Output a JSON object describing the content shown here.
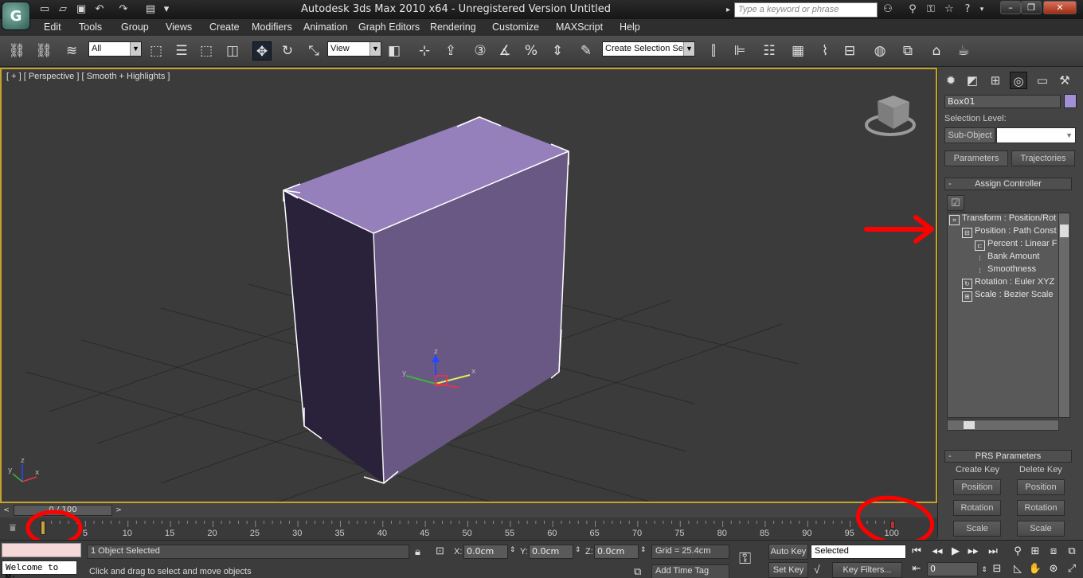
{
  "window": {
    "title": "Autodesk 3ds Max  2010 x64  -  Unregistered Version     Untitled",
    "search_placeholder": "Type a keyword or phrase"
  },
  "menu": [
    "Edit",
    "Tools",
    "Group",
    "Views",
    "Create",
    "Modifiers",
    "Animation",
    "Graph Editors",
    "Rendering",
    "Customize",
    "MAXScript",
    "Help"
  ],
  "toolbar": {
    "selection_filter": "All",
    "reference_coord": "View",
    "named_selection": "Create Selection Se"
  },
  "viewport": {
    "label": "[ + ] [ Perspective ] [ Smooth + Highlights ]",
    "object_color": "#a38fd6",
    "gizmo_labels": {
      "x": "x",
      "y": "y",
      "z": "z"
    }
  },
  "command_panel": {
    "object_name": "Box01",
    "selection_level_label": "Selection Level:",
    "sub_object_label": "Sub-Object",
    "tab_parameters": "Parameters",
    "tab_trajectories": "Trajectories",
    "assign_controller_title": "Assign Controller",
    "tree": [
      {
        "label": "Transform : Position/Rot",
        "indent": 0
      },
      {
        "label": "Position : Path Const",
        "indent": 1
      },
      {
        "label": "Percent : Linear F",
        "indent": 2
      },
      {
        "label": "Bank Amount",
        "indent": 2
      },
      {
        "label": "Smoothness",
        "indent": 2
      },
      {
        "label": "Rotation : Euler XYZ",
        "indent": 1
      },
      {
        "label": "Scale : Bezier Scale",
        "indent": 1
      }
    ],
    "prs_title": "PRS Parameters",
    "create_key": "Create Key",
    "delete_key": "Delete Key",
    "position": "Position",
    "rotation": "Rotation",
    "scale": "Scale"
  },
  "timeline": {
    "slider_label": "0 / 100",
    "current_frame": 0,
    "total_frames": 100,
    "ticks": [
      "5",
      "10",
      "15",
      "20",
      "25",
      "30",
      "35",
      "40",
      "45",
      "50",
      "55",
      "60",
      "65",
      "70",
      "75",
      "80",
      "85",
      "90",
      "95",
      "100"
    ]
  },
  "status": {
    "maxscript_listener": "Welcome to M:",
    "selection_info": "1 Object Selected",
    "prompt": "Click and drag to select and move objects",
    "x_label": "X:",
    "y_label": "Y:",
    "z_label": "Z:",
    "x_value": "0.0cm",
    "y_value": "0.0cm",
    "z_value": "0.0cm",
    "grid": "Grid = 25.4cm",
    "add_time_tag": "Add Time Tag",
    "auto_key": "Auto Key",
    "set_key": "Set Key",
    "key_mode": "Selected",
    "key_filters": "Key Filters...",
    "frame_value": "0"
  },
  "annotation_color": "#ff0000"
}
